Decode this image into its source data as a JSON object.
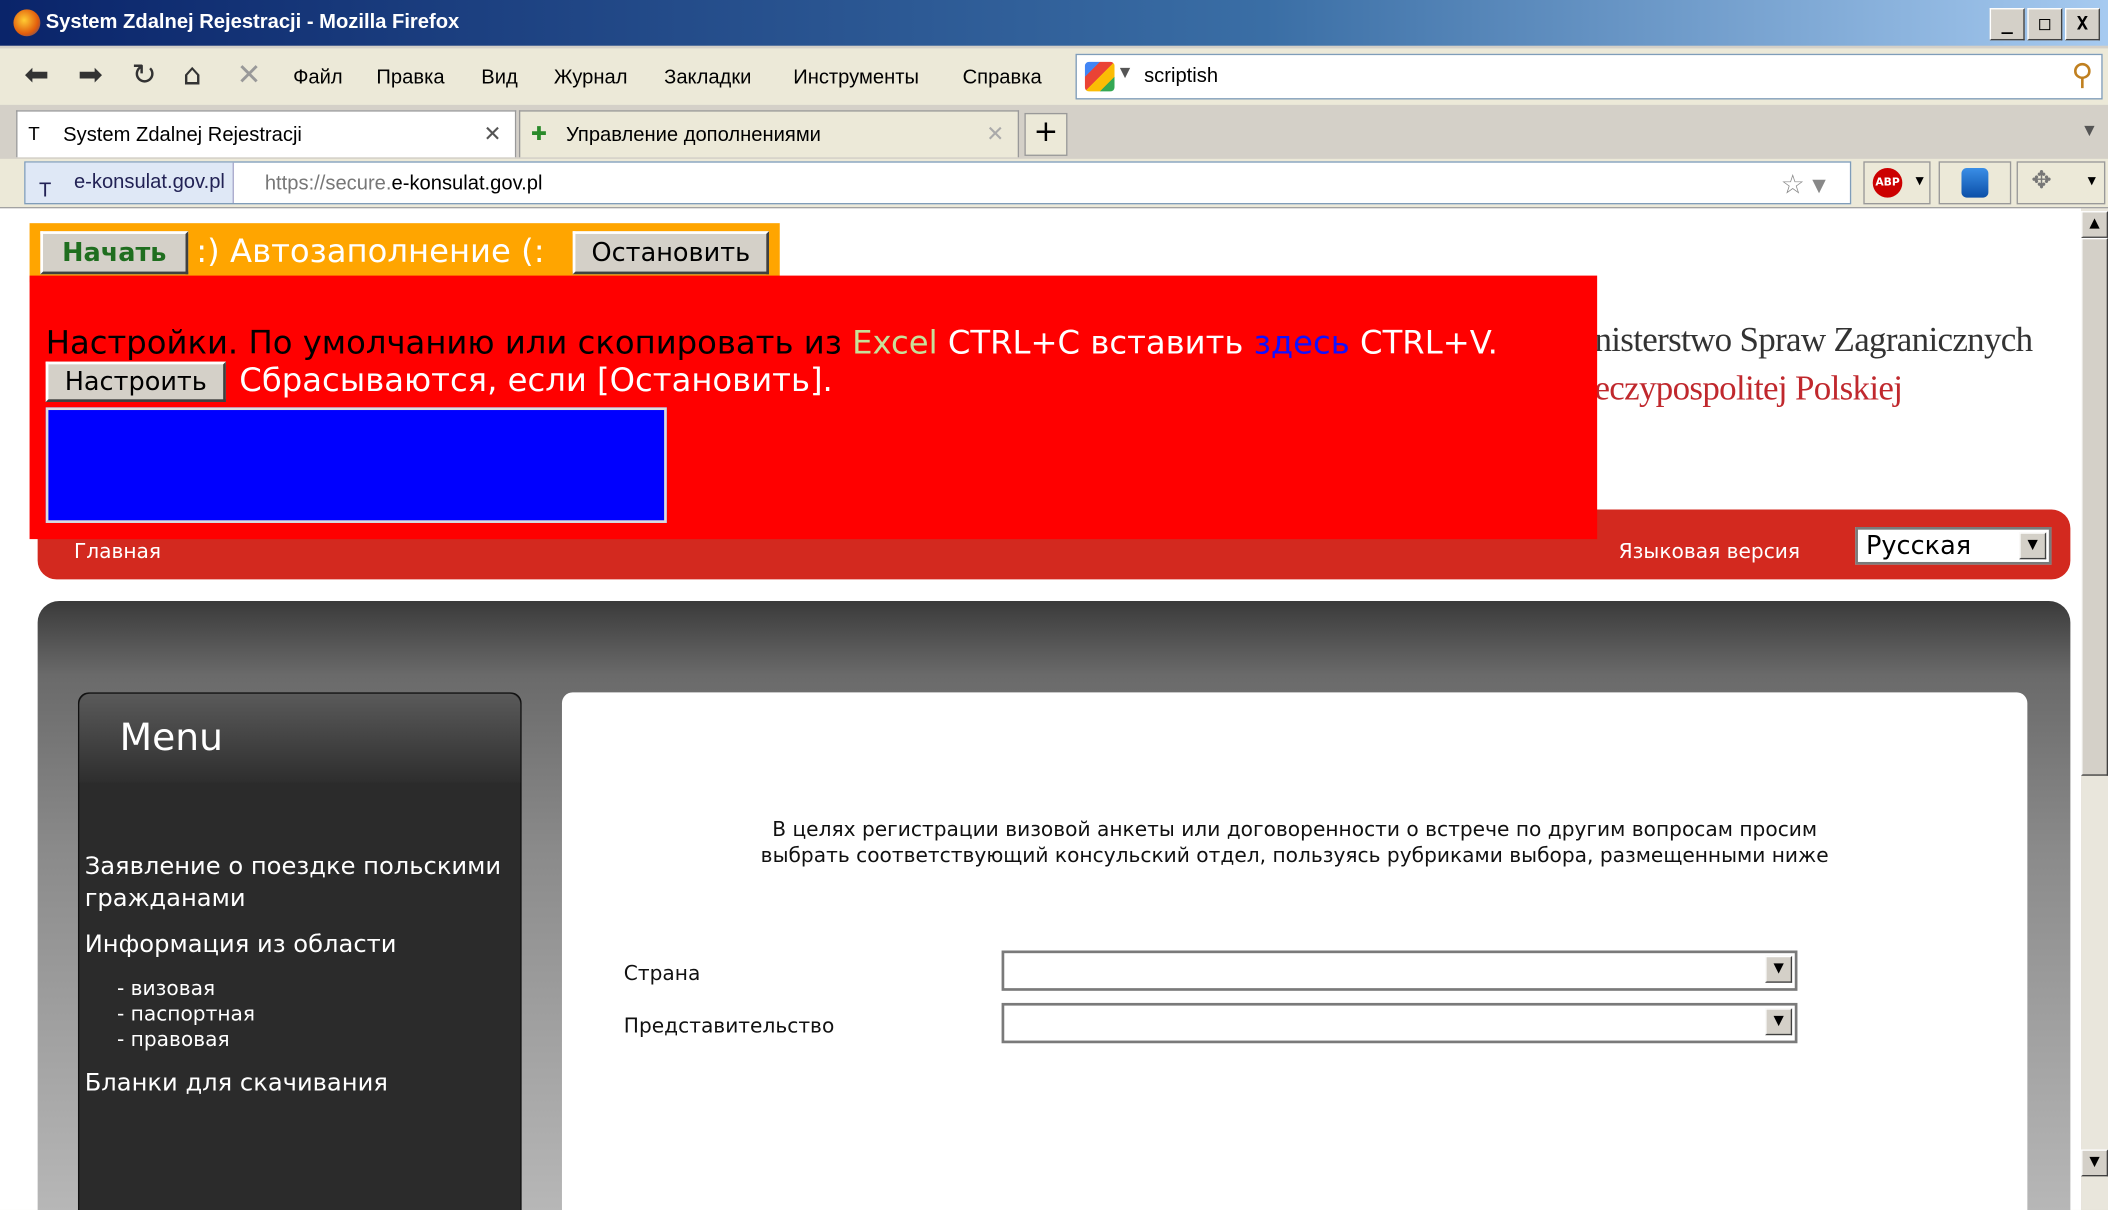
{
  "window": {
    "title": "System Zdalnej Rejestracji - Mozilla Firefox",
    "controls": [
      "_",
      "□",
      "X"
    ]
  },
  "menubar": {
    "items": [
      "Файл",
      "Правка",
      "Вид",
      "Журнал",
      "Закладки",
      "Инструменты",
      "Справка"
    ]
  },
  "search": {
    "value": "scriptish"
  },
  "tabs": [
    {
      "label": "System Zdalnej Rejestracji"
    },
    {
      "label": "Управление дополнениями"
    }
  ],
  "urlbar": {
    "site": "e-konsulat.gov.pl",
    "url_prefix": "https://secure.",
    "url_domain": "e-konsulat.gov.pl"
  },
  "overlay": {
    "start_label": "Начать",
    "autofill_text": ":) Автозаполнение (:",
    "stop_label": "Остановить",
    "settings_part1": "Настройки. По умолчанию или скопировать из ",
    "settings_excel": "Excel",
    "settings_part2": " CTRL+C вставить ",
    "settings_here": "здесь",
    "settings_part3": " CTRL+V.",
    "configure_label": "Настроить",
    "reset_text": "Сбрасываются, если [Остановить]."
  },
  "header": {
    "ministry_line1": "nisterstwo Spraw Zagranicznych",
    "ministry_line2": "eczypospolitej Polskiej"
  },
  "nav": {
    "home": "Главная",
    "lang_label": "Языковая версия",
    "lang_value": "Русская"
  },
  "menu": {
    "title": "Menu",
    "items": [
      "Заявление о поездке польскими гражданами",
      "Информация из области",
      "Бланки для скачивания"
    ],
    "subitems": [
      "- визовая",
      "- паспортная",
      "- правовая"
    ]
  },
  "content": {
    "intro_line1": "В целях регистрации визовой анкеты или договоренности о встрече по другим вопросам просим",
    "intro_line2": "выбрать соответствующий консульский отдел, пользуясь рубриками выбора, размещенными ниже",
    "country_label": "Страна",
    "country_value": "",
    "office_label": "Представительство",
    "office_value": ""
  },
  "colors": {
    "nav_red": "#d3291f",
    "overlay_red": "#ff0000",
    "overlay_orange": "#ffa500",
    "textarea_blue": "#0000ff"
  }
}
